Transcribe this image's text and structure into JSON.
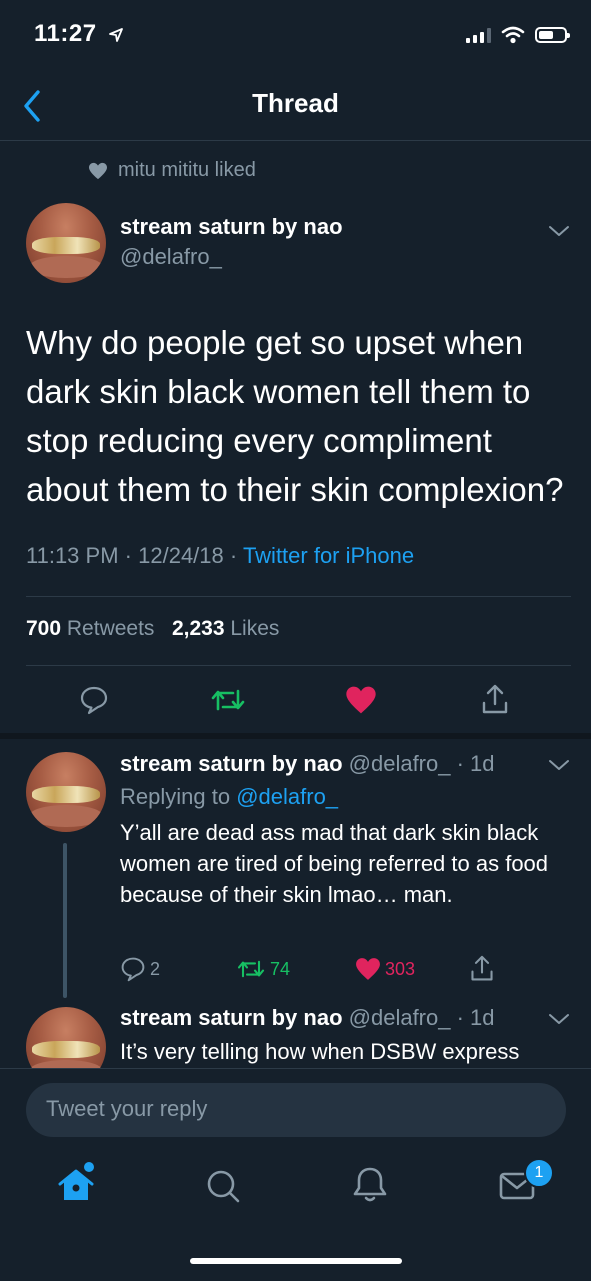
{
  "status_bar": {
    "time": "11:27"
  },
  "nav": {
    "title": "Thread"
  },
  "context": {
    "liked_by": "mitu mititu liked"
  },
  "tweet": {
    "display_name": "stream saturn by nao",
    "handle": "@delafro_",
    "text": "Why do people get so upset when dark skin black women tell them to stop reducing every compliment about them to their skin complexion?",
    "time": "11:13 PM",
    "date": "12/24/18",
    "source": "Twitter for iPhone",
    "retweets_count": "700",
    "retweets_label": "Retweets",
    "likes_count": "2,233",
    "likes_label": "Likes"
  },
  "replies": [
    {
      "display_name": "stream saturn by nao",
      "handle": "@delafro_",
      "age": "· 1d",
      "replying_prefix": "Replying to",
      "replying_to": "@delafro_",
      "text": "Y’all are dead ass mad that dark skin black women are tired of being referred to as food because of their skin lmao… man.",
      "reply_count": "2",
      "retweet_count": "74",
      "like_count": "303"
    },
    {
      "display_name": "stream saturn by nao",
      "handle": "@delafro_",
      "age": "· 1d",
      "text": "It’s very telling how when DSBW express"
    }
  ],
  "composer": {
    "placeholder": "Tweet your reply"
  },
  "tabs": [
    {
      "icon": "home-icon"
    },
    {
      "icon": "search-icon"
    },
    {
      "icon": "bell-icon"
    },
    {
      "icon": "mail-icon",
      "badge": "1"
    }
  ],
  "colors": {
    "background": "#15202b",
    "accent": "#1da1f2",
    "retweet": "#17bf63",
    "like": "#e0245e",
    "muted": "#8899a6"
  }
}
